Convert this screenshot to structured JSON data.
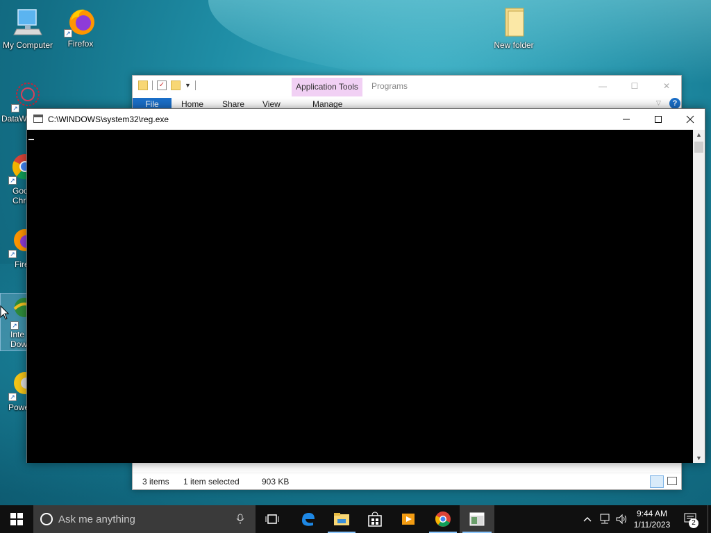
{
  "desktop": {
    "icons": [
      {
        "label": "My Computer",
        "icon": "computer-icon"
      },
      {
        "label": "Firefox",
        "icon": "firefox-icon"
      },
      {
        "label": "New folder",
        "icon": "folder-icon"
      },
      {
        "label": "DataW",
        "icon": "datawrapper-icon"
      },
      {
        "label": "Goo\nChro",
        "icon": "chrome-icon"
      },
      {
        "label": "Fire",
        "icon": "firefox-icon"
      },
      {
        "label": "Inte\nDow",
        "icon": "internet-download-manager-icon"
      },
      {
        "label": "Powe",
        "icon": "power-icon"
      }
    ]
  },
  "explorer": {
    "ribbon_context": "Application Tools",
    "title": "Programs",
    "tabs": [
      "File",
      "Home",
      "Share",
      "View",
      "Manage"
    ],
    "status": {
      "items": "3 items",
      "selected": "1 item selected",
      "size": "903 KB"
    }
  },
  "console": {
    "title": "C:\\WINDOWS\\system32\\reg.exe"
  },
  "taskbar": {
    "search_placeholder": "Ask me anything",
    "time": "9:44 AM",
    "date": "1/11/2023",
    "notifications": "2",
    "pinned": [
      "task-view",
      "edge",
      "file-explorer",
      "store",
      "media-player",
      "chrome",
      "reg-console"
    ]
  },
  "colors": {
    "accent": "#1a6fc9",
    "app_tools": "#f1d0f4",
    "taskbar": "#101010"
  }
}
